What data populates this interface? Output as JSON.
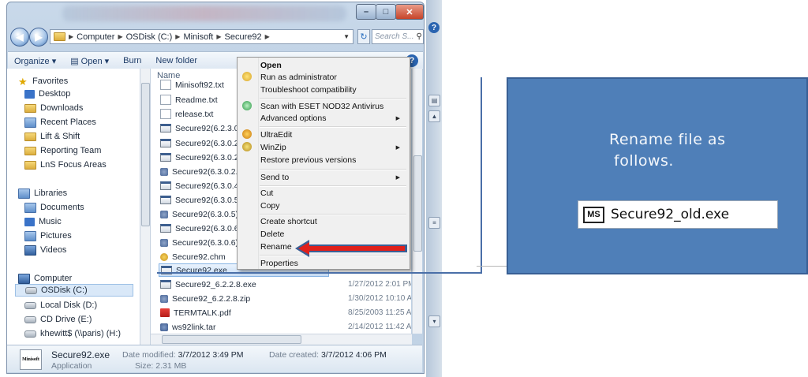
{
  "explorer": {
    "nav": {
      "breadcrumb": [
        "Computer",
        "OSDisk (C:)",
        "Minisoft",
        "Secure92"
      ],
      "search_placeholder": "Search S..."
    },
    "toolbar": {
      "organize": "Organize ▾",
      "open": "Open ▾",
      "burn": "Burn",
      "new_folder": "New folder"
    },
    "navpane": {
      "favorites": "Favorites",
      "desktop": "Desktop",
      "downloads": "Downloads",
      "recent_places": "Recent Places",
      "lift_shift": "Lift & Shift",
      "reporting_team": "Reporting Team",
      "lns_focus": "LnS Focus Areas",
      "libraries": "Libraries",
      "documents": "Documents",
      "music": "Music",
      "pictures": "Pictures",
      "videos": "Videos",
      "computer": "Computer",
      "osdisk": "OSDisk (C:)",
      "local_disk": "Local Disk (D:)",
      "cd_drive": "CD Drive (E:)",
      "network": "khewitt$ (\\\\paris) (H:)"
    },
    "files": {
      "col_name": "Name",
      "rows": [
        {
          "name": "Minisoft92.txt",
          "date": ""
        },
        {
          "name": "Readme.txt",
          "date": ""
        },
        {
          "name": "release.txt",
          "date": ""
        },
        {
          "name": "Secure92(6.2.3.0).e",
          "date": ""
        },
        {
          "name": "Secure92(6.3.0.2).e",
          "date": ""
        },
        {
          "name": "Secure92(6.3.0.2.1)",
          "date": ""
        },
        {
          "name": "Secure92(6.3.0.2.4)",
          "date": ""
        },
        {
          "name": "Secure92(6.3.0.4)F.",
          "date": ""
        },
        {
          "name": "Secure92(6.3.0.5).e",
          "date": ""
        },
        {
          "name": "Secure92(6.3.0.5).z",
          "date": ""
        },
        {
          "name": "Secure92(6.3.0.6).e",
          "date": ""
        },
        {
          "name": "Secure92(6.3.0.6)F.",
          "date": ""
        },
        {
          "name": "Secure92.chm",
          "date": ""
        },
        {
          "name": "Secure92.exe",
          "date": ""
        },
        {
          "name": "Secure92_6.2.2.8.exe",
          "date": "1/27/2012 2:01 PM"
        },
        {
          "name": "Secure92_6.2.2.8.zip",
          "date": "1/30/2012 10:10 A..."
        },
        {
          "name": "TERMTALK.pdf",
          "date": "8/25/2003 11:25 A..."
        },
        {
          "name": "ws92link.tar",
          "date": "2/14/2012 11:42 A..."
        }
      ]
    },
    "details": {
      "icon_text": "Minisoft",
      "name": "Secure92.exe",
      "modified_label": "Date modified:",
      "modified": "3/7/2012 3:49 PM",
      "created_label": "Date created:",
      "created": "3/7/2012 4:06 PM",
      "type": "Application",
      "size_label": "Size:",
      "size": "2.31 MB"
    }
  },
  "context_menu": {
    "open": "Open",
    "run_admin": "Run as administrator",
    "troubleshoot": "Troubleshoot compatibility",
    "scan": "Scan with ESET NOD32 Antivirus",
    "advanced": "Advanced options",
    "ultraedit": "UltraEdit",
    "winzip": "WinZip",
    "restore": "Restore previous versions",
    "send_to": "Send to",
    "cut": "Cut",
    "copy": "Copy",
    "create_shortcut": "Create shortcut",
    "delete": "Delete",
    "rename": "Rename",
    "properties": "Properties"
  },
  "callout": {
    "line1": "Rename file as",
    "line2": "follows.",
    "ms_icon": "MS",
    "new_name": "Secure92_old.exe"
  },
  "colors": {
    "callout_fill": "#4f7fb8",
    "arrow_red": "#e0201b",
    "arrow_outline": "#3a5f95"
  }
}
